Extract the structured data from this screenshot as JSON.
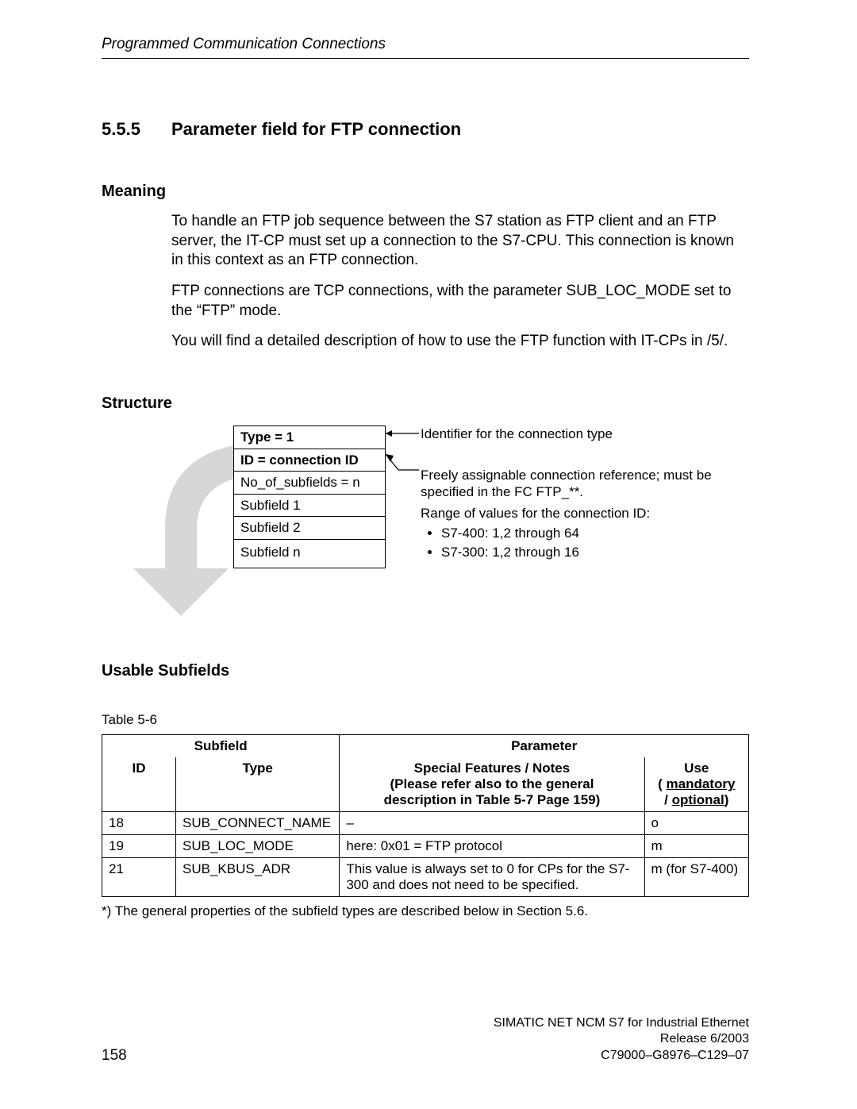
{
  "header": {
    "running_title": "Programmed Communication Connections"
  },
  "section": {
    "number": "5.5.5",
    "title": "Parameter field for FTP connection"
  },
  "meaning": {
    "heading": "Meaning",
    "p1": "To handle an FTP job sequence between the S7 station as FTP client and an FTP server, the IT-CP must set up a connection to the S7-CPU. This connection is known in this context as an FTP connection.",
    "p2": "FTP connections are TCP connections, with the parameter SUB_LOC_MODE  set to the “FTP” mode.",
    "p3": "You will find a detailed description of how to use the FTP function with IT-CPs in /5/."
  },
  "structure": {
    "heading": "Structure",
    "rows": {
      "type": "Type = 1",
      "id": "ID = connection ID",
      "no_sub": "No_of_subfields = n",
      "sub1": "Subfield 1",
      "sub2": "Subfield 2",
      "subn": "Subfield n"
    },
    "annot1": "Identifier for the connection type",
    "annot2": "Freely assignable connection reference; must be specified in the FC FTP_**.",
    "annot3_intro": "Range of values for the connection ID:",
    "annot3_b1": "S7-400: 1,2 through 64",
    "annot3_b2": "S7-300: 1,2 through 16"
  },
  "usable": {
    "heading": "Usable Subfields",
    "caption": "Table 5-6",
    "group_subfield": "Subfield",
    "group_parameter": "Parameter",
    "col_id": "ID",
    "col_type": "Type",
    "col_notes_l1": "Special Features / Notes",
    "col_notes_l2": "(Please refer also to the general",
    "col_notes_l3": "description in Table 5-7 Page 159)",
    "col_use_l1": "Use",
    "col_use_l2a": "( ",
    "col_use_l2b": "mandatory",
    "col_use_l3a": "/ ",
    "col_use_l3b": "optional",
    "col_use_l3c": ")",
    "rows": [
      {
        "id": "18",
        "type": "SUB_CONNECT_NAME",
        "notes": "–",
        "use": "o"
      },
      {
        "id": "19",
        "type": "SUB_LOC_MODE",
        "notes": "here: 0x01 = FTP protocol",
        "use": "m"
      },
      {
        "id": "21",
        "type": "SUB_KBUS_ADR",
        "notes": "This value is always set to 0 for CPs for the S7-300 and does not need to be specified.",
        "use": "m (for S7-400)"
      }
    ],
    "footnote": "*) The general properties of the subfield types are described below in Section 5.6."
  },
  "footer": {
    "page": "158",
    "line1": "SIMATIC NET NCM S7 for Industrial Ethernet",
    "line2": "Release 6/2003",
    "line3": "C79000–G8976–C129–07"
  }
}
